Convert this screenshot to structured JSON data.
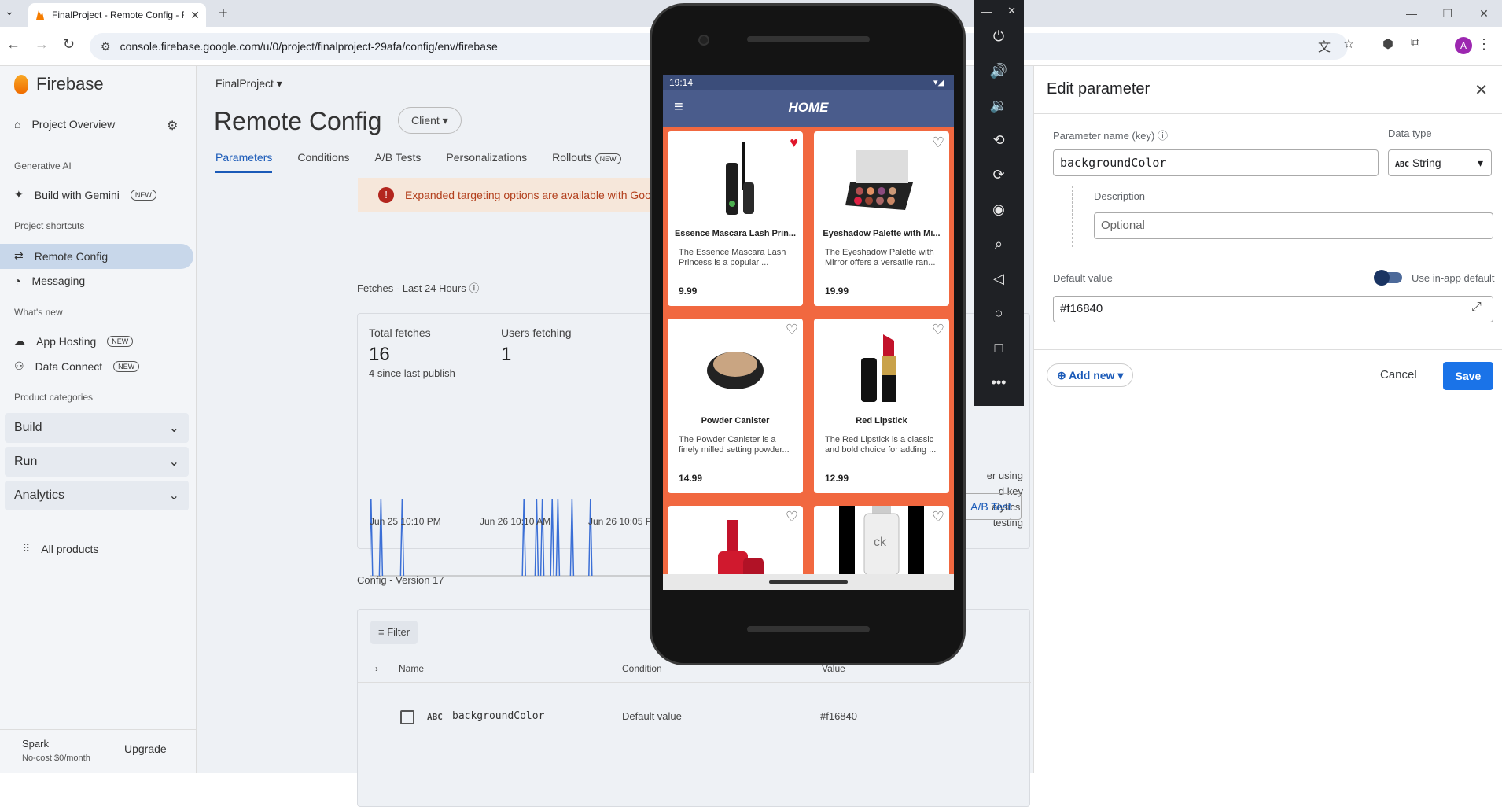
{
  "browser": {
    "tab_title": "FinalProject - Remote Config - F",
    "url": "console.firebase.google.com/u/0/project/finalproject-29afa/config/env/firebase",
    "avatar_letter": "A"
  },
  "sidebar": {
    "brand": "Firebase",
    "overview": "Project Overview",
    "gen_ai_head": "Generative AI",
    "build_gemini": "Build with Gemini",
    "new_badge": "NEW",
    "shortcuts_head": "Project shortcuts",
    "remote_config": "Remote Config",
    "messaging": "Messaging",
    "whats_new_head": "What's new",
    "app_hosting": "App Hosting",
    "data_connect": "Data Connect",
    "categories_head": "Product categories",
    "build": "Build",
    "run": "Run",
    "analytics": "Analytics",
    "all_products": "All products",
    "plan": "Spark",
    "plan_sub": "No-cost $0/month",
    "upgrade": "Upgrade"
  },
  "main": {
    "project": "FinalProject",
    "title": "Remote Config",
    "client_chip": "Client",
    "tabs": [
      "Parameters",
      "Conditions",
      "A/B Tests",
      "Personalizations",
      "Rollouts"
    ],
    "banner": "Expanded targeting options are available with Goo",
    "fetches_label": "Fetches - Last 24 Hours",
    "total_fetches_label": "Total fetches",
    "total_fetches_value": "16",
    "since_publish": "4 since last publish",
    "users_fetching_label": "Users fetching",
    "users_fetching_value": "1",
    "x_ticks": [
      "Jun 25 10:10 PM",
      "Jun 26 10:10 AM",
      "Jun 26 10:05 P"
    ],
    "side_text": [
      "er using",
      "d key",
      "alytics,",
      "testing"
    ],
    "ab_button": "A/B Test",
    "version_label": "Config - Version 17",
    "filter": "Filter",
    "col_name": "Name",
    "col_condition": "Condition",
    "col_value": "Value",
    "row_type": "ABC",
    "row_name": "backgroundColor",
    "row_condition": "Default value",
    "row_value": "#f16840"
  },
  "chart_data": {
    "type": "bar",
    "x": [
      "Jun 25 10:10 PM",
      "Jun 26 10:10 AM",
      "Jun 26 10:05 P"
    ],
    "spike_positions": [
      0.005,
      0.04,
      0.115,
      0.545,
      0.59,
      0.61,
      0.645,
      0.665,
      0.715,
      0.78
    ],
    "ylabel": "",
    "xlabel": ""
  },
  "phone": {
    "time": "19:14",
    "app_title": "HOME",
    "products": [
      {
        "name": "Essence Mascara Lash Prin...",
        "desc": "The Essence Mascara Lash Princess is a popular ...",
        "price": "9.99",
        "liked": true
      },
      {
        "name": "Eyeshadow Palette with Mi...",
        "desc": "The Eyeshadow Palette with Mirror offers a versatile ran...",
        "price": "19.99",
        "liked": false
      },
      {
        "name": "Powder Canister",
        "desc": "The Powder Canister is a finely milled setting powder...",
        "price": "14.99",
        "liked": false
      },
      {
        "name": "Red Lipstick",
        "desc": "The Red Lipstick is a classic and bold choice for adding ...",
        "price": "12.99",
        "liked": false
      },
      {
        "name": "",
        "desc": "",
        "price": "",
        "liked": false
      },
      {
        "name": "",
        "desc": "",
        "price": "",
        "liked": false
      }
    ],
    "perfume_label": "ck"
  },
  "panel": {
    "title": "Edit parameter",
    "param_name_label": "Parameter name (key)",
    "param_name_value": "backgroundColor",
    "data_type_label": "Data type",
    "data_type_value": "String",
    "data_type_icon": "ABC",
    "description_label": "Description",
    "description_placeholder": "Optional",
    "default_value_label": "Default value",
    "use_inapp_label": "Use in-app default",
    "default_value": "#f16840",
    "add_new": "Add new",
    "cancel": "Cancel",
    "save": "Save",
    "colors": {
      "accent": "#1a73e8",
      "app_background": "#f16840"
    }
  }
}
